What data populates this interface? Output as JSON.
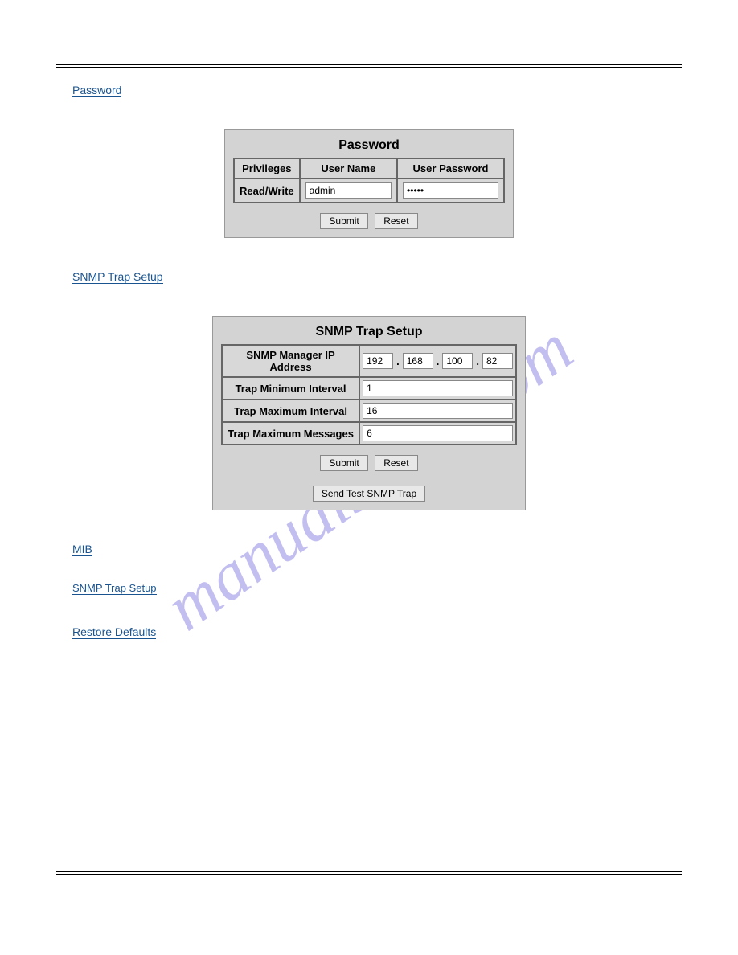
{
  "watermark": "manualshive.com",
  "sections": {
    "password_link": "Password",
    "snmp_link": "SNMP Trap Setup",
    "mib_link": "MIB",
    "restore_link": "Restore Defaults",
    "inline_link": "SNMP Trap Setup"
  },
  "password_panel": {
    "title": "Password",
    "headers": [
      "Privileges",
      "User Name",
      "User Password"
    ],
    "row": {
      "privileges": "Read/Write",
      "username": "admin",
      "password": "•••••"
    },
    "submit": "Submit",
    "reset": "Reset"
  },
  "snmp_panel": {
    "title": "SNMP Trap Setup",
    "rows": [
      {
        "label": "SNMP Manager IP Address",
        "type": "ip",
        "values": [
          "192",
          "168",
          "100",
          "82"
        ]
      },
      {
        "label": "Trap Minimum Interval",
        "type": "text",
        "value": "1"
      },
      {
        "label": "Trap Maximum Interval",
        "type": "text",
        "value": "16"
      },
      {
        "label": "Trap Maximum Messages",
        "type": "text",
        "value": "6"
      }
    ],
    "submit": "Submit",
    "reset": "Reset",
    "send_test": "Send Test SNMP Trap"
  }
}
